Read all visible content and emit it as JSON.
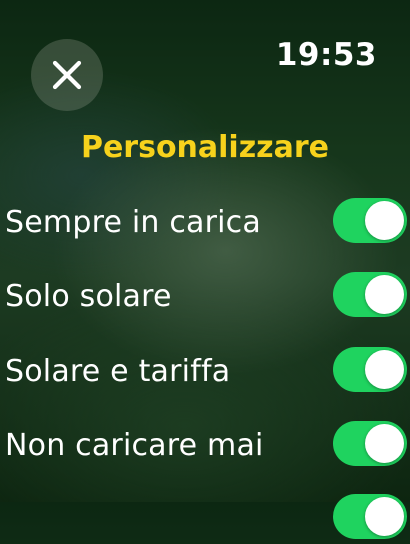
{
  "header": {
    "close_icon": "close-icon",
    "time": "19:53"
  },
  "title": "Personalizzare",
  "options": [
    {
      "label": "Sempre in carica",
      "enabled": true
    },
    {
      "label": "Solo solare",
      "enabled": true
    },
    {
      "label": "Solare e tariffa",
      "enabled": true
    },
    {
      "label": "Non caricare mai",
      "enabled": true
    },
    {
      "label": "",
      "enabled": true
    }
  ],
  "colors": {
    "accent_title": "#f7d21c",
    "toggle_on": "#1fd35f",
    "background": "#16361b"
  }
}
